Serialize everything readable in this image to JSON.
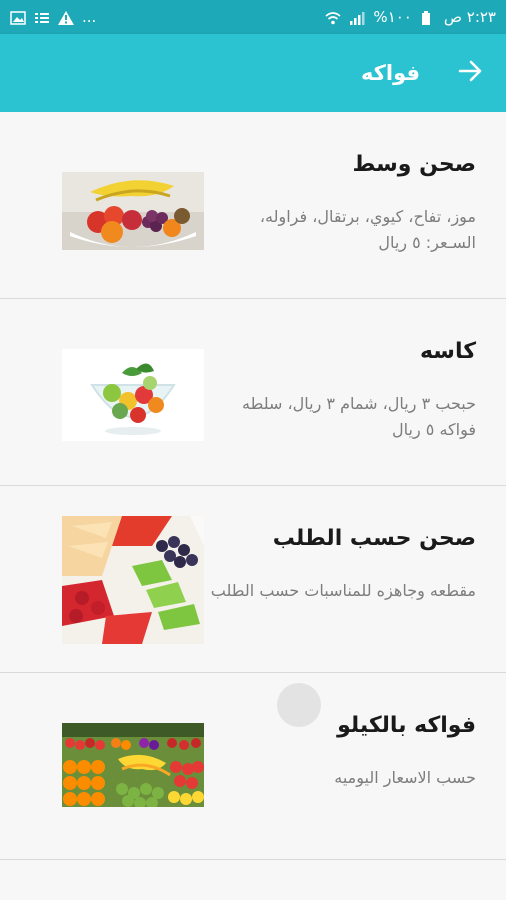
{
  "status_bar": {
    "time": "٢:٢٣ ص",
    "battery": "%١٠٠",
    "dots": "..."
  },
  "toolbar": {
    "title": "فواكه",
    "back_icon": "arrow-right-icon"
  },
  "items": [
    {
      "title": "صحن وسط",
      "description": "موز، تفاح، كيوي، برتقال، فراوله، السـعر: ٥ ريال",
      "image": "fruit-bowl-image"
    },
    {
      "title": "كاسه",
      "description": "حبحب ٣ ريال، شمام ٣ ريال، سلطه فواكه ٥ ريال",
      "image": "fruit-cup-image"
    },
    {
      "title": "صحن حسب الطلب",
      "description": "مقطعه وجاهزه للمناسبات حسب الطلب",
      "image": "fruit-platter-image"
    },
    {
      "title": "فواكه بالكيلو",
      "description": "حسب الاسعار اليوميه",
      "image": "fruit-market-image"
    }
  ],
  "colors": {
    "status_bar": "#1ea9b8",
    "toolbar": "#2bc3d2"
  }
}
